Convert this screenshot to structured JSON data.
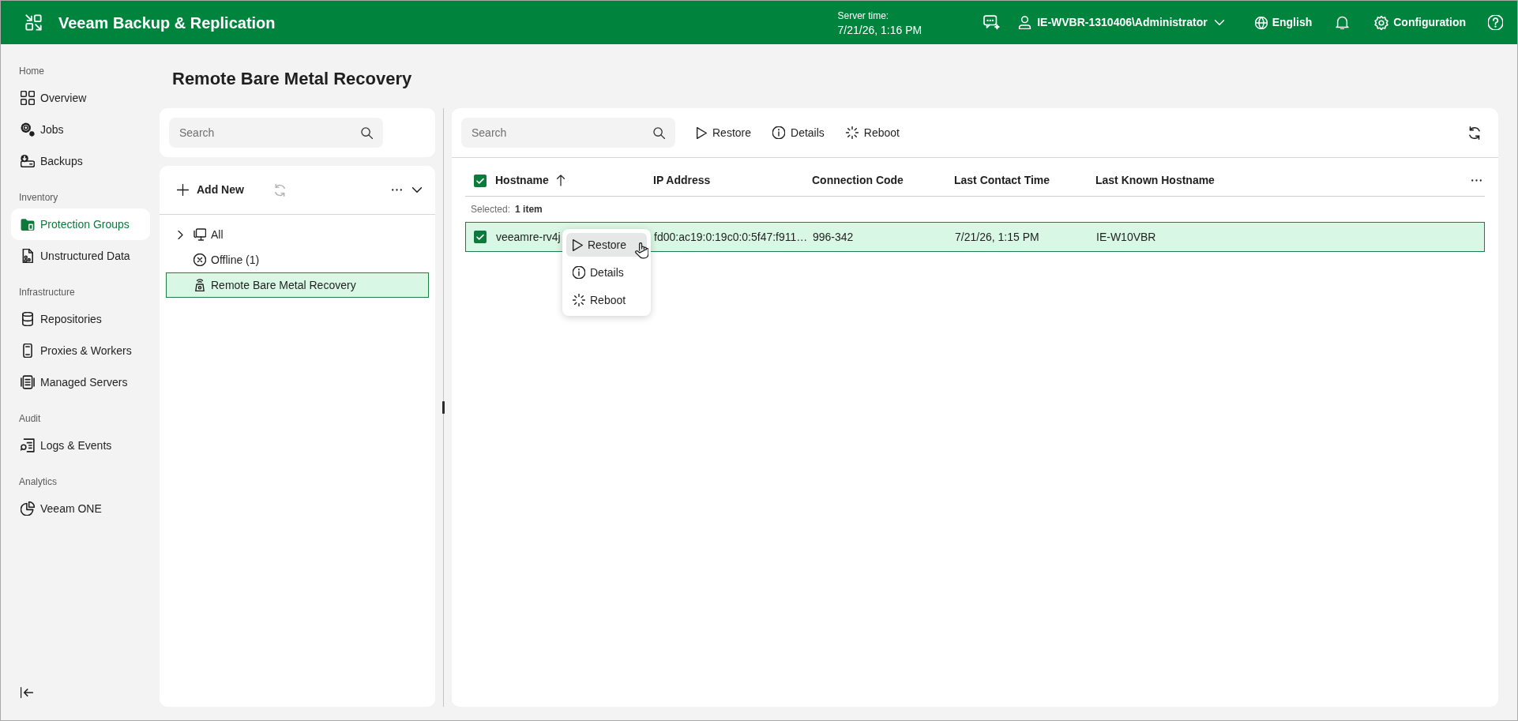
{
  "header": {
    "title": "Veeam Backup & Replication",
    "server_time": {
      "label": "Server time:",
      "value": "7/21/26, 1:16 PM"
    },
    "user": "IE-WVBR-1310406\\Administrator",
    "language": "English",
    "configuration": "Configuration"
  },
  "sidebar": {
    "sections": [
      {
        "title": "Home",
        "items": [
          {
            "label": "Overview",
            "selected": false
          },
          {
            "label": "Jobs",
            "selected": false
          },
          {
            "label": "Backups",
            "selected": false
          }
        ]
      },
      {
        "title": "Inventory",
        "items": [
          {
            "label": "Protection Groups",
            "selected": true
          },
          {
            "label": "Unstructured Data",
            "selected": false
          }
        ]
      },
      {
        "title": "Infrastructure",
        "items": [
          {
            "label": "Repositories",
            "selected": false
          },
          {
            "label": "Proxies & Workers",
            "selected": false
          },
          {
            "label": "Managed Servers",
            "selected": false
          }
        ]
      },
      {
        "title": "Audit",
        "items": [
          {
            "label": "Logs & Events",
            "selected": false
          }
        ]
      },
      {
        "title": "Analytics",
        "items": [
          {
            "label": "Veeam ONE",
            "selected": false
          }
        ]
      }
    ]
  },
  "page_title": "Remote Bare Metal Recovery",
  "tree_panel": {
    "search": {
      "placeholder": "Search"
    },
    "toolbar": {
      "add_label": "Add New",
      "refresh_disabled": true
    },
    "nodes": [
      {
        "label": "All",
        "expanded": false,
        "selected": false
      },
      {
        "label": "Offline (1)",
        "selected": false
      },
      {
        "label": "Remote Bare Metal Recovery",
        "selected": true
      }
    ]
  },
  "hosts_panel": {
    "search": {
      "placeholder": "Search"
    },
    "actions": [
      {
        "label": "Restore"
      },
      {
        "label": "Details"
      },
      {
        "label": "Reboot"
      }
    ],
    "table": {
      "all_checked": true,
      "columns": [
        {
          "label": "Hostname",
          "sorted": true
        },
        {
          "label": "IP Address",
          "sorted": false
        },
        {
          "label": "Connection Code",
          "sorted": false
        },
        {
          "label": "Last Contact Time",
          "sorted": false
        },
        {
          "label": "Last Known Hostname",
          "sorted": false
        }
      ],
      "selection": {
        "label": "Selected:",
        "value": "1 item"
      },
      "rows": [
        {
          "checked": true,
          "selected": true,
          "cells": [
            "veeamre-rv4j",
            "fd00:ac19:0:19c0:0:5f47:f911…",
            "996-342",
            "7/21/26, 1:15 PM",
            "IE-W10VBR"
          ]
        }
      ]
    },
    "context_menu": {
      "items": [
        {
          "label": "Restore",
          "selected": true
        },
        {
          "label": "Details",
          "selected": false
        },
        {
          "label": "Reboot",
          "selected": false
        }
      ]
    }
  }
}
